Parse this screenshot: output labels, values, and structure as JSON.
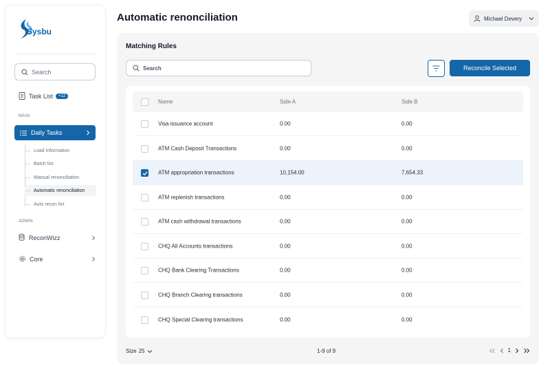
{
  "sidebar": {
    "logo_text": "Sysbu",
    "search_placeholder": "Search",
    "task_list": {
      "label": "Task List",
      "badge": "+12"
    },
    "section_main": "MAIN",
    "daily_tasks": "Daily Tasks",
    "sub_items": [
      "Load information",
      "Batch list",
      "Manual renonciliation",
      "Automatic renonciliation",
      "Auto recon list"
    ],
    "section_admin": "ADMIN",
    "reconwizz": "ReconWizz",
    "core": "Core"
  },
  "header": {
    "title": "Automatic renonciliation",
    "user": "Michael Devery"
  },
  "panel": {
    "title": "Matching Rules",
    "search_placeholder": "Search",
    "reconcile_label": "Reconcile Selected"
  },
  "table": {
    "columns": [
      "Name",
      "Side A",
      "Side B"
    ],
    "rows": [
      {
        "name": "Visa issuance account",
        "side_a": "0.00",
        "side_b": "0.00",
        "selected": false
      },
      {
        "name": "ATM Cash Deposit Transactions",
        "side_a": "0.00",
        "side_b": "0.00",
        "selected": false
      },
      {
        "name": "ATM appropriation transactions",
        "side_a": "10,154.00",
        "side_b": "7,654.33",
        "selected": true
      },
      {
        "name": "ATM replenish transactions",
        "side_a": "0.00",
        "side_b": "0.00",
        "selected": false
      },
      {
        "name": "ATM cash withdrawal transactions",
        "side_a": "0.00",
        "side_b": "0.00",
        "selected": false
      },
      {
        "name": "CHQ All Accounts transactions",
        "side_a": "0.00",
        "side_b": "0.00",
        "selected": false
      },
      {
        "name": "CHQ Bank Clearing Transactions",
        "side_a": "0.00",
        "side_b": "0.00",
        "selected": false
      },
      {
        "name": "CHQ Branch Clearing transactions",
        "side_a": "0.00",
        "side_b": "0.00",
        "selected": false
      },
      {
        "name": "CHQ Special Clearing transactions",
        "side_a": "0.00",
        "side_b": "0.00",
        "selected": false
      }
    ]
  },
  "footer": {
    "size_label": "Size",
    "size_value": "25",
    "range": "1-9 of 9",
    "page": "1"
  },
  "colors": {
    "accent": "#1466a8",
    "selected_row": "#edf3fa",
    "panel_bg": "#f5f5f6"
  },
  "icons": [
    "logo-swoosh",
    "search-icon",
    "task-list-icon",
    "list-icon",
    "chevron-right-icon",
    "database-icon",
    "gear-icon",
    "user-icon",
    "chevron-down-icon",
    "filter-icon",
    "checkmark-icon",
    "first-page-icon",
    "prev-page-icon",
    "next-page-icon",
    "last-page-icon"
  ]
}
